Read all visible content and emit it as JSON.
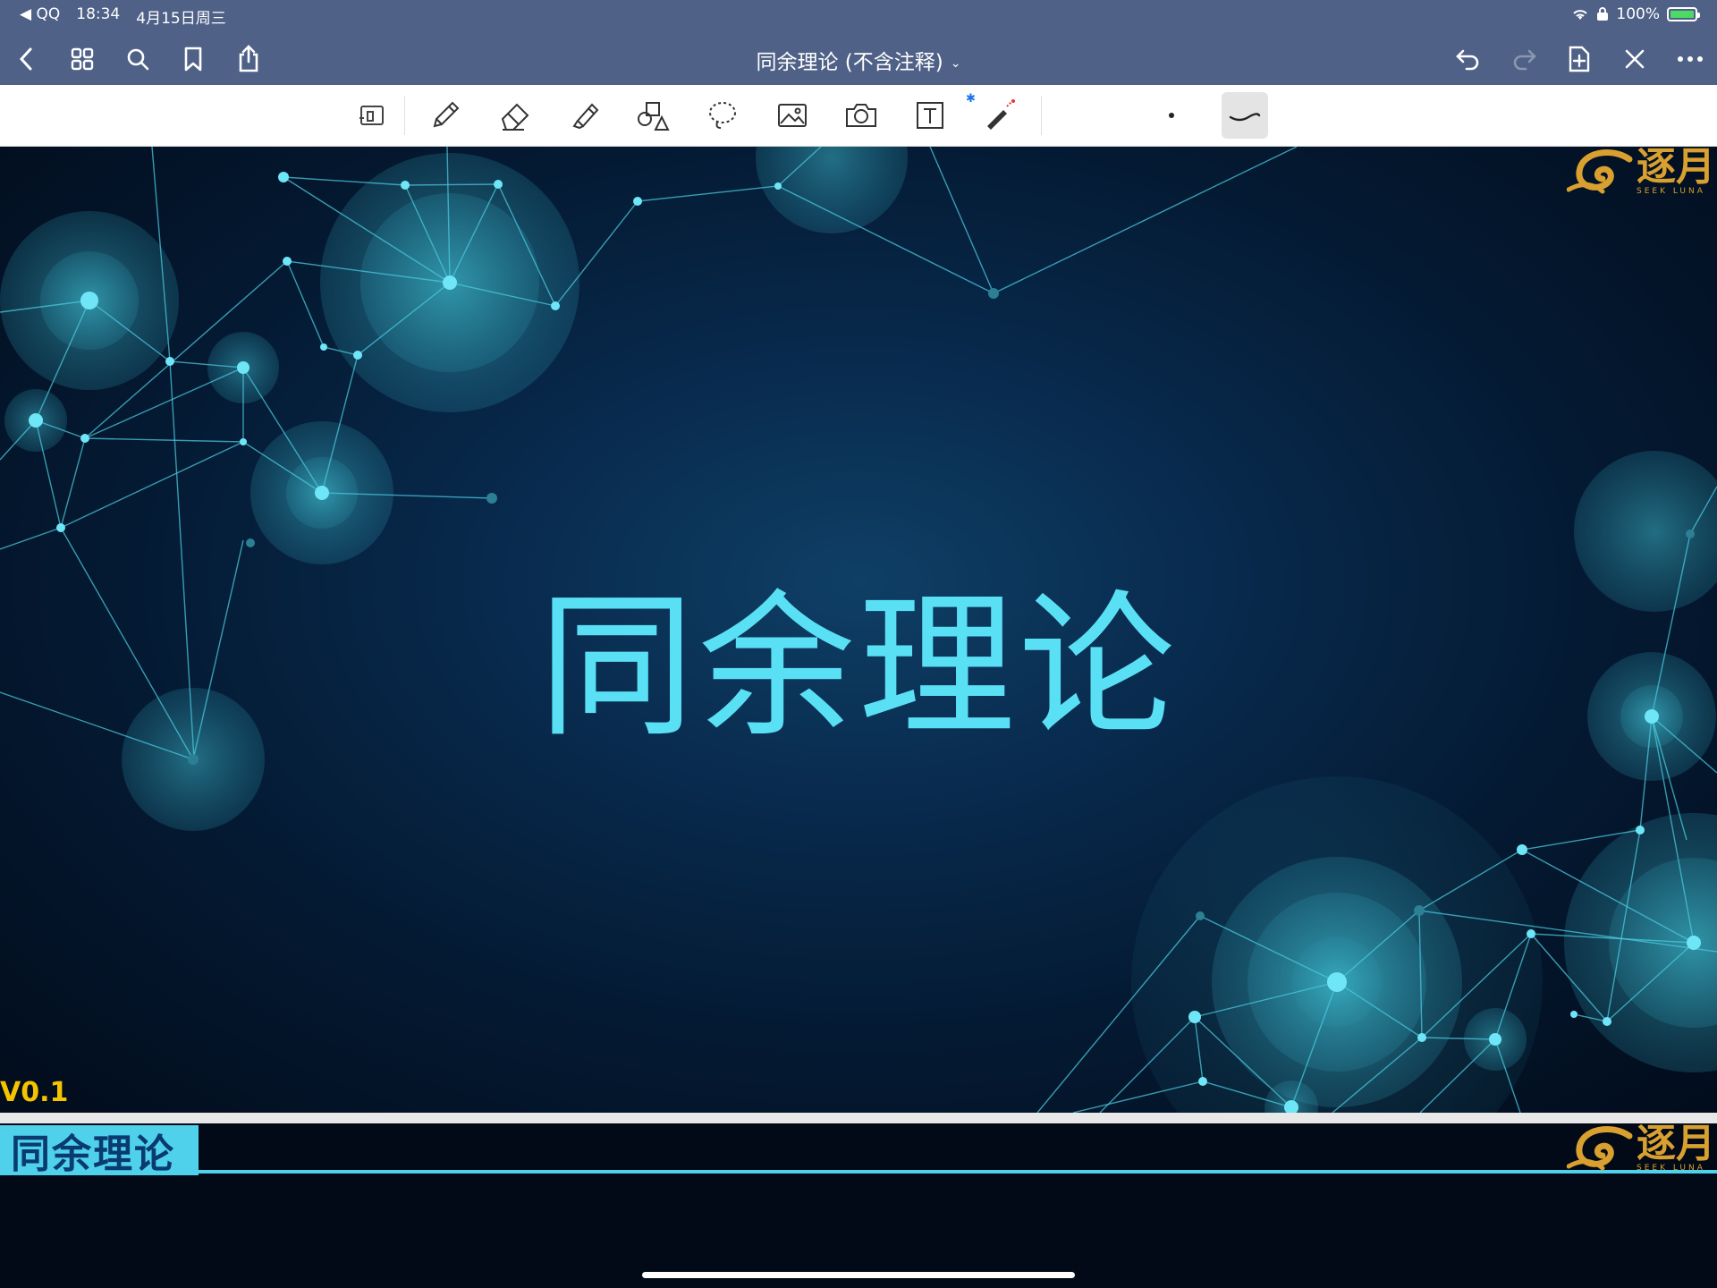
{
  "status_bar": {
    "back_app": "◀ QQ",
    "time": "18:34",
    "date": "4月15日周三",
    "battery": "100%"
  },
  "nav": {
    "title": "同余理论 (不含注释)",
    "title_chevron": "⌄"
  },
  "toolbar": {
    "bluetooth_mark": "✱"
  },
  "slide": {
    "title": "同余理论",
    "version": "V0.1",
    "logo_cn": "逐月",
    "logo_en": "SEEK LUNA"
  },
  "next_page": {
    "header_title": "同余理论",
    "logo_cn": "逐月",
    "logo_en": "SEEK LUNA"
  },
  "colors": {
    "nav_bg": "#4f6187",
    "title_cyan": "#5ae0f5",
    "version_yellow": "#f5c400",
    "logo_gold": "#d9a030"
  }
}
